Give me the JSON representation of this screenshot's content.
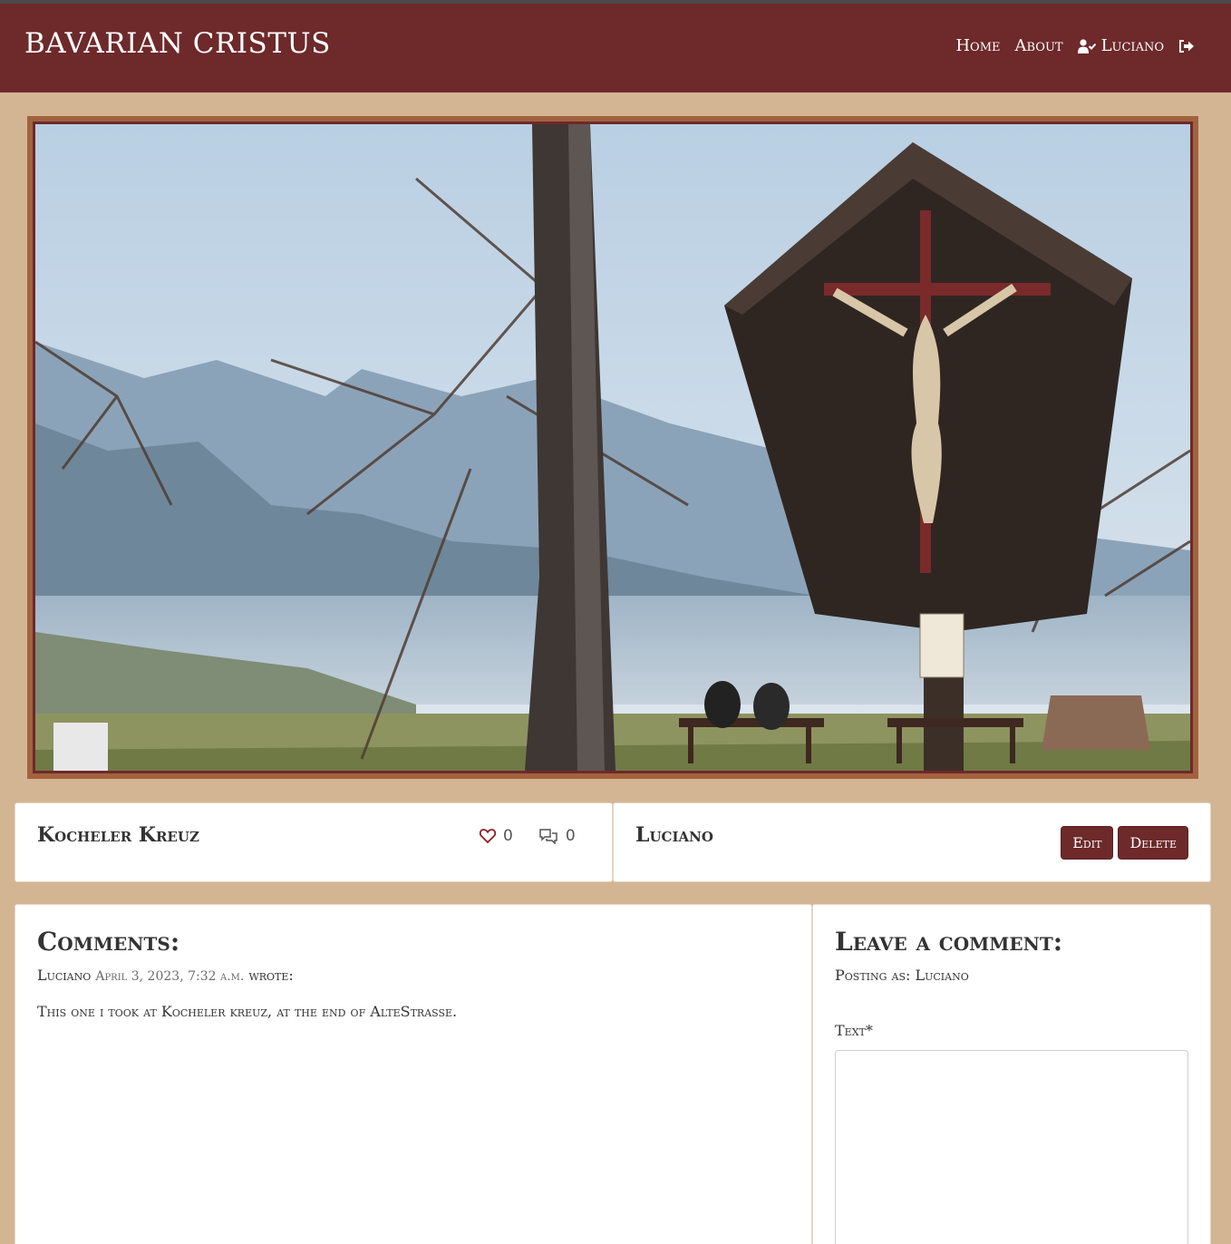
{
  "navbar": {
    "brand": "BAVARIAN CRISTUS",
    "links": [
      "Home",
      "About"
    ],
    "user": "Luciano",
    "user_icon": "user-check-icon",
    "logout_icon": "sign-out-icon",
    "color": "#6e292a"
  },
  "hero": {
    "image_icon": "wayside-crucifix-photo"
  },
  "post": {
    "title": "Kocheler Kreuz",
    "likes": "0",
    "comments_count": "0",
    "like_icon": "heart-icon",
    "comment_icon": "comments-icon"
  },
  "author": {
    "name": "Luciano",
    "edit_label": "Edit",
    "delete_label": "Delete"
  },
  "comments": {
    "heading": "Comments:",
    "items": [
      {
        "author": "Luciano",
        "date": "April 3, 2023, 7:32 a.m.",
        "wrote": "wrote:",
        "body": "This one i took at Kocheler kreuz, at the end of AlteStrasse."
      }
    ]
  },
  "form": {
    "heading": "Leave a comment:",
    "posting_as_label": "Posting as:",
    "posting_as_user": "Luciano",
    "text_label": "Text*",
    "text_value": ""
  },
  "colors": {
    "background": "#d4b593",
    "accent": "#6e292a",
    "frame": "#a1633f"
  }
}
